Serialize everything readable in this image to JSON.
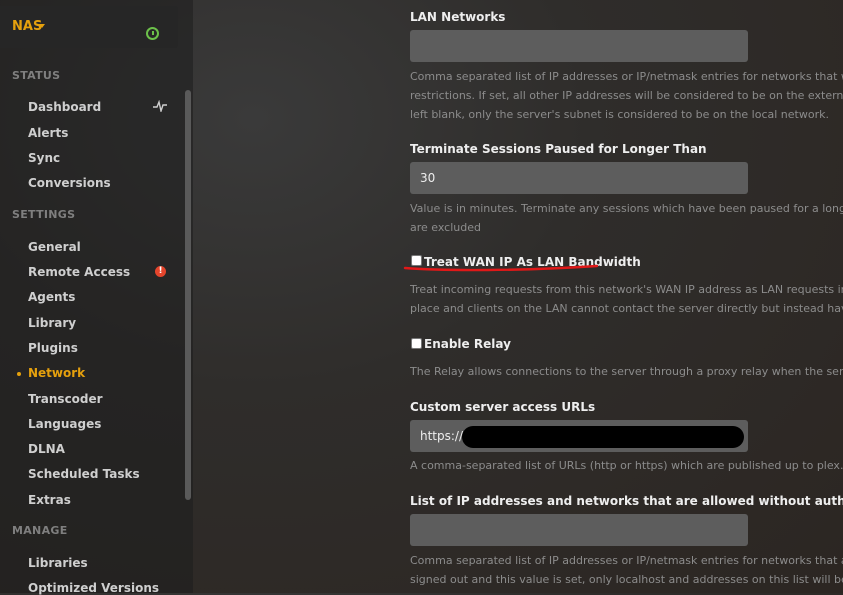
{
  "server": {
    "name": "NAS",
    "status_icon": "power-icon",
    "accent": "#e5a00d"
  },
  "sidebar": {
    "status_heading": "STATUS",
    "status_items": [
      {
        "label": "Dashboard",
        "icon": "activity-icon"
      },
      {
        "label": "Alerts"
      },
      {
        "label": "Sync"
      },
      {
        "label": "Conversions"
      }
    ],
    "settings_heading": "SETTINGS",
    "settings_items": [
      {
        "label": "General"
      },
      {
        "label": "Remote Access",
        "badge": "!"
      },
      {
        "label": "Agents"
      },
      {
        "label": "Library"
      },
      {
        "label": "Plugins"
      },
      {
        "label": "Network",
        "active": true
      },
      {
        "label": "Transcoder"
      },
      {
        "label": "Languages"
      },
      {
        "label": "DLNA"
      },
      {
        "label": "Scheduled Tasks"
      },
      {
        "label": "Extras"
      }
    ],
    "manage_heading": "MANAGE",
    "manage_items": [
      {
        "label": "Libraries"
      },
      {
        "label": "Optimized Versions"
      }
    ]
  },
  "settings": {
    "lan_networks": {
      "label": "LAN Networks",
      "value": "",
      "help": [
        "Comma separated list of IP addresses or IP/netmask entries for networks that will",
        "restrictions. If set, all other IP addresses will be considered to be on the external n",
        "left blank, only the server's subnet is considered to be on the local network."
      ]
    },
    "terminate_sessions": {
      "label": "Terminate Sessions Paused for Longer Than",
      "value": "30",
      "help": [
        "Value is in minutes. Terminate any sessions which have been paused for a longer t",
        "are excluded"
      ]
    },
    "treat_wan": {
      "label": "Treat WAN IP As LAN Bandwidth",
      "checked": false,
      "help": [
        "Treat incoming requests from this network's WAN IP address as LAN requests in te",
        "place and clients on the LAN cannot contact the server directly but instead have to"
      ]
    },
    "enable_relay": {
      "label": "Enable Relay",
      "checked": false,
      "help": [
        "The Relay allows connections to the server through a proxy relay when the server i"
      ]
    },
    "custom_urls": {
      "label": "Custom server access URLs",
      "value": "https://",
      "help": [
        "A comma-separated list of URLs (http or https) which are published up to plex.tv fo"
      ]
    },
    "allowed_without_auth": {
      "label": "List of IP addresses and networks that are allowed without auth",
      "value": "",
      "help": [
        "Comma separated list of IP addresses or IP/netmask entries for networks that are",
        "signed out and this value is set, only localhost and addresses on this list will be allo"
      ]
    }
  }
}
